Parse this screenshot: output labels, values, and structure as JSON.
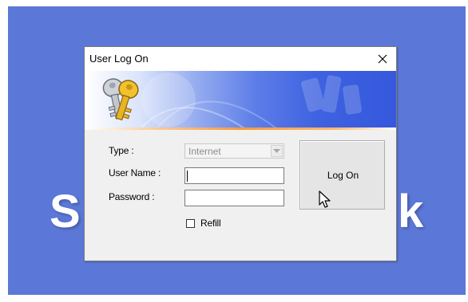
{
  "desktop": {
    "background_color": "#5b78d8",
    "brand_fragment_left": "S",
    "brand_fragment_right": "k"
  },
  "dialog": {
    "title": "User Log On",
    "close_icon": "close-icon",
    "banner_icon": "keys-icon"
  },
  "form": {
    "type_label": "Type :",
    "type_value": "Internet",
    "type_enabled": false,
    "username_label": "User Name :",
    "username_value": "",
    "password_label": "Password :",
    "password_value": "",
    "refill_label": "Refill",
    "refill_checked": false
  },
  "actions": {
    "logon_label": "Log On"
  }
}
